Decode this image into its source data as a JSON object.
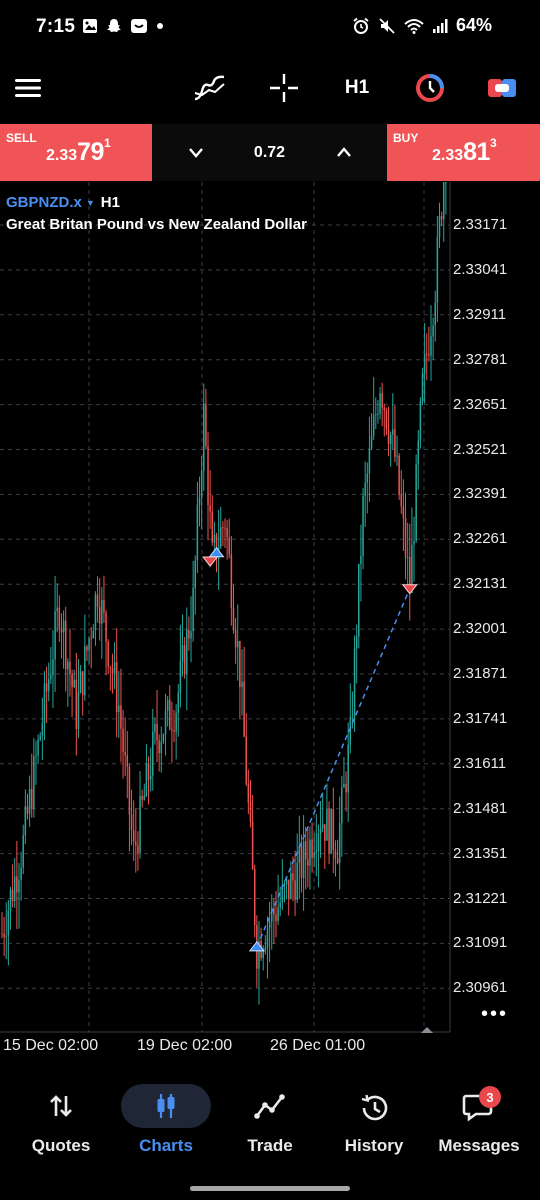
{
  "status_bar": {
    "time": "7:15",
    "battery": "64%"
  },
  "toolbar": {
    "timeframe": "H1"
  },
  "trade": {
    "sell_label": "SELL",
    "sell_price": {
      "small": "2.33",
      "big": "79",
      "sup": "1"
    },
    "spread": "0.72",
    "buy_label": "BUY",
    "buy_price": {
      "small": "2.33",
      "big": "81",
      "sup": "3"
    }
  },
  "symbol": {
    "name": "GBPNZD.x",
    "timeframe": "H1",
    "description": "Great Britan Pound vs New Zealand Dollar"
  },
  "chart_data": {
    "type": "candlestick",
    "y_ticks": [
      "2.33171",
      "2.33041",
      "2.32911",
      "2.32781",
      "2.32651",
      "2.32521",
      "2.32391",
      "2.32261",
      "2.32131",
      "2.32001",
      "2.31871",
      "2.31741",
      "2.31611",
      "2.31481",
      "2.31351",
      "2.31221",
      "2.31091",
      "2.30961"
    ],
    "x_ticks": [
      "15 Dec 02:00",
      "19 Dec 02:00",
      "26 Dec 01:00"
    ],
    "ylim": [
      2.3088,
      2.333
    ],
    "grid": true,
    "colors": {
      "up": "#26a69a",
      "down": "#ef5350",
      "grid": "#3a3d45",
      "trade_line": "#4a8ff0"
    },
    "trades": [
      {
        "type": "buy",
        "time_index": 120,
        "price": 2.31081
      },
      {
        "type": "sell",
        "time_index": 192,
        "price": 2.32118
      },
      {
        "type": "sell",
        "time_index": 98,
        "price": 2.32198
      },
      {
        "type": "buy",
        "time_index": 101,
        "price": 2.32222
      }
    ]
  },
  "nav": {
    "quotes": "Quotes",
    "charts": "Charts",
    "trade": "Trade",
    "history": "History",
    "messages": "Messages",
    "messages_badge": "3"
  }
}
